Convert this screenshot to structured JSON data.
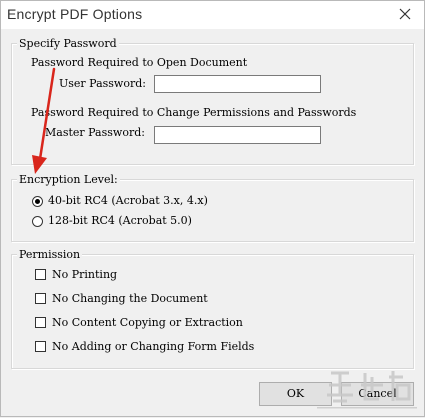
{
  "window": {
    "title": "Encrypt PDF Options"
  },
  "password_group": {
    "legend": "Specify Password",
    "open_heading": "Password Required to Open Document",
    "user_label": "User Password:",
    "user_value": "",
    "perm_heading": "Password Required to Change Permissions and Passwords",
    "master_label": "Master Password:",
    "master_value": ""
  },
  "encryption_group": {
    "legend": "Encryption Level:",
    "options": [
      {
        "label": "40-bit RC4 (Acrobat 3.x, 4.x)",
        "selected": true
      },
      {
        "label": "128-bit RC4 (Acrobat 5.0)",
        "selected": false
      }
    ]
  },
  "permission_group": {
    "legend": "Permission",
    "options": [
      {
        "label": "No Printing",
        "checked": false
      },
      {
        "label": "No Changing the Document",
        "checked": false
      },
      {
        "label": "No Content Copying or Extraction",
        "checked": false
      },
      {
        "label": "No Adding or Changing Form Fields",
        "checked": false
      }
    ]
  },
  "buttons": {
    "ok": "OK",
    "cancel": "Cancel"
  },
  "colors": {
    "annotation_arrow": "#d9261c"
  }
}
